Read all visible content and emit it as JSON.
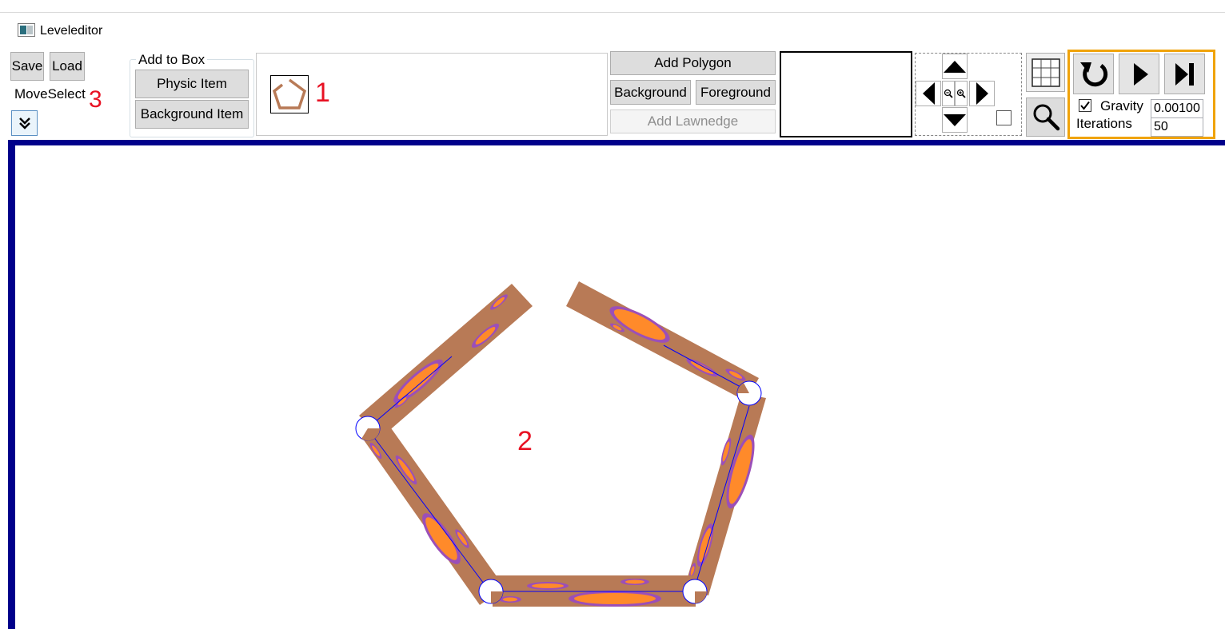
{
  "window": {
    "title": "Leveleditor"
  },
  "file_buttons": {
    "save": "Save",
    "load": "Load"
  },
  "mode_label": "MoveSelect",
  "annotations": {
    "one": "1",
    "two": "2",
    "three": "3"
  },
  "add_to_box": {
    "title": "Add to Box",
    "physic_item": "Physic Item",
    "background_item": "Background Item"
  },
  "polygon_panel": {
    "add_polygon": "Add Polygon",
    "background": "Background",
    "foreground": "Foreground",
    "add_lawnedge": "Add Lawnedge"
  },
  "navigation": {
    "up": "arrow-up",
    "down": "arrow-down",
    "left": "arrow-left",
    "right": "arrow-right",
    "zoom_out": "zoom-out",
    "zoom_in": "zoom-in"
  },
  "simulation": {
    "gravity_label": "Gravity",
    "gravity_checked": true,
    "gravity_value": "0.00100",
    "iterations_label": "Iterations",
    "iterations_value": "50"
  },
  "colors": {
    "canvas_border": "#00008b",
    "wood": "#b87a56",
    "knot_outer": "#9b4fb8",
    "knot_inner": "#ff8a2a",
    "edge_line": "#0000ff",
    "highlight_border": "#f0a30a",
    "annotation_red": "#e81123"
  }
}
